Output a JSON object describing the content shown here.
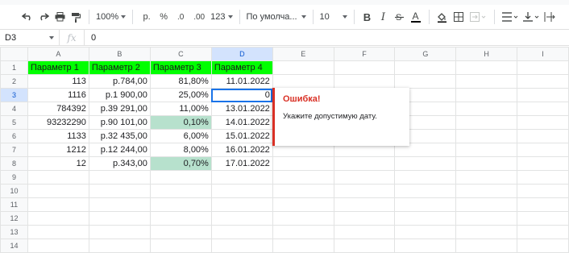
{
  "toolbar": {
    "zoom": "100%",
    "currency": "р.",
    "percent": "%",
    "dec_decrease": ".0",
    "dec_increase": ".00",
    "more_formats": "123",
    "font_name": "По умолча...",
    "font_size": "10",
    "bold": "B",
    "italic": "I",
    "text_color": "A"
  },
  "formula_bar": {
    "cell_ref": "D3",
    "fx": "fx",
    "value": "0"
  },
  "columns": [
    "A",
    "B",
    "C",
    "D",
    "E",
    "F",
    "G",
    "H",
    "I"
  ],
  "rows": [
    "1",
    "2",
    "3",
    "4",
    "5",
    "6",
    "7",
    "8",
    "9",
    "10",
    "11",
    "12",
    "13",
    "14"
  ],
  "cells": {
    "r1": [
      "Параметр 1",
      "Параметр 2",
      "Параметр 3",
      "Параметр 4"
    ],
    "r2": [
      "113",
      "р.784,00",
      "81,80%",
      "11.01.2022"
    ],
    "r3": [
      "1116",
      "р.1 900,00",
      "25,00%",
      "0"
    ],
    "r4": [
      "784392",
      "р.39 291,00",
      "11,00%",
      "13.01.2022"
    ],
    "r5": [
      "93232290",
      "р.90 101,00",
      "0,10%",
      "14.01.2022"
    ],
    "r6": [
      "1133",
      "р.32 435,00",
      "6,00%",
      "15.01.2022"
    ],
    "r7": [
      "1212",
      "р.12 244,00",
      "8,00%",
      "16.01.2022"
    ],
    "r8": [
      "12",
      "р.343,00",
      "0,70%",
      "17.01.2022"
    ]
  },
  "error_popup": {
    "title": "Ошибка!",
    "message": "Укажите допустимую дату."
  },
  "colors": {
    "header_fill": "#00ff00",
    "highlight_fill": "#b7e1cd",
    "error": "#d93025",
    "selection": "#1a73e8"
  }
}
